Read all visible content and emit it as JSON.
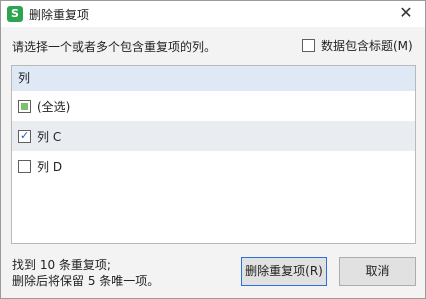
{
  "window": {
    "title": "删除重复项",
    "app_icon_letter": "S",
    "close_glyph": "✕"
  },
  "prompt": "请选择一个或者多个包含重复项的列。",
  "header_option": {
    "label": "数据包含标题(M)",
    "checked": false
  },
  "list": {
    "header": "列",
    "items": [
      {
        "label": "(全选)",
        "state": "partial"
      },
      {
        "label": "列 C",
        "state": "checked"
      },
      {
        "label": "列 D",
        "state": "unchecked"
      }
    ]
  },
  "status": {
    "line1": "找到 10 条重复项;",
    "line2": "删除后将保留 5 条唯一项。"
  },
  "buttons": {
    "delete": "删除重复项(R)",
    "cancel": "取消"
  }
}
